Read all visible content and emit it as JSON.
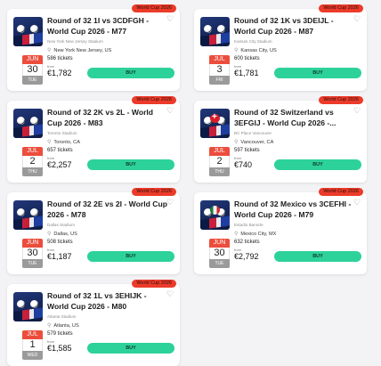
{
  "cards": [
    {
      "tag": "World Cup 2026",
      "title": "Round of 32 1I vs 3CDFGH - World Cup 2026 - M77",
      "venue": "New York New Jersey Stadium",
      "location": "New York New Jersey, US",
      "month": "JUN",
      "day": "30",
      "weekday": "TUE",
      "tickets": "586 tickets",
      "from": "from",
      "price": "€1,782",
      "buy": "BUY",
      "flag": "none"
    },
    {
      "tag": "World Cup 2026",
      "title": "Round of 32 1K vs 3DEIJL - World Cup 2026 - M87",
      "venue": "Kansas City Stadium",
      "location": "Kansas City, US",
      "month": "JUL",
      "day": "3",
      "weekday": "FRI",
      "tickets": "600 tickets",
      "from": "from",
      "price": "€1,781",
      "buy": "BUY",
      "flag": "none"
    },
    {
      "tag": "World Cup 2026",
      "title": "Round of 32 2K vs 2L - World Cup 2026 - M83",
      "venue": "Toronto Stadium",
      "location": "Toronto, CA",
      "month": "JUL",
      "day": "2",
      "weekday": "THU",
      "tickets": "657 tickets",
      "from": "from",
      "price": "€2,257",
      "buy": "BUY",
      "flag": "none"
    },
    {
      "tag": "World Cup 2026",
      "title": "Round of 32 Switzerland vs 3EFGIJ - World Cup 2026 -...",
      "venue": "BC Place Vancouver",
      "location": "Vancouver, CA",
      "month": "JUL",
      "day": "2",
      "weekday": "THU",
      "tickets": "597 tickets",
      "from": "from",
      "price": "€740",
      "buy": "BUY",
      "flag": "ch"
    },
    {
      "tag": "World Cup 2026",
      "title": "Round of 32 2E vs 2I - World Cup 2026 - M78",
      "venue": "Dallas Stadium",
      "location": "Dallas, US",
      "month": "JUN",
      "day": "30",
      "weekday": "TUE",
      "tickets": "508 tickets",
      "from": "from",
      "price": "€1,187",
      "buy": "BUY",
      "flag": "none"
    },
    {
      "tag": "World Cup 2026",
      "title": "Round of 32 Mexico vs 3CEFHI - World Cup 2026 - M79",
      "venue": "Estadio Banorte",
      "location": "Mexico City, MX",
      "month": "JUN",
      "day": "30",
      "weekday": "TUE",
      "tickets": "632 tickets",
      "from": "from",
      "price": "€2,792",
      "buy": "BUY",
      "flag": "mx"
    },
    {
      "tag": "World Cup 2026",
      "title": "Round of 32 1L vs 3EHIJK - World Cup 2026 - M80",
      "venue": "Atlanta Stadium",
      "location": "Atlanta, US",
      "month": "JUL",
      "day": "1",
      "weekday": "WED",
      "tickets": "579 tickets",
      "from": "from",
      "price": "€1,585",
      "buy": "BUY",
      "flag": "none"
    }
  ],
  "icons": {
    "heart": "heart-icon",
    "pin": "location-pin-icon"
  },
  "colors": {
    "tag": "#ec3b2a",
    "buy": "#2dd29a",
    "month": "#ec4d3c",
    "weekday": "#9a9a9a"
  }
}
